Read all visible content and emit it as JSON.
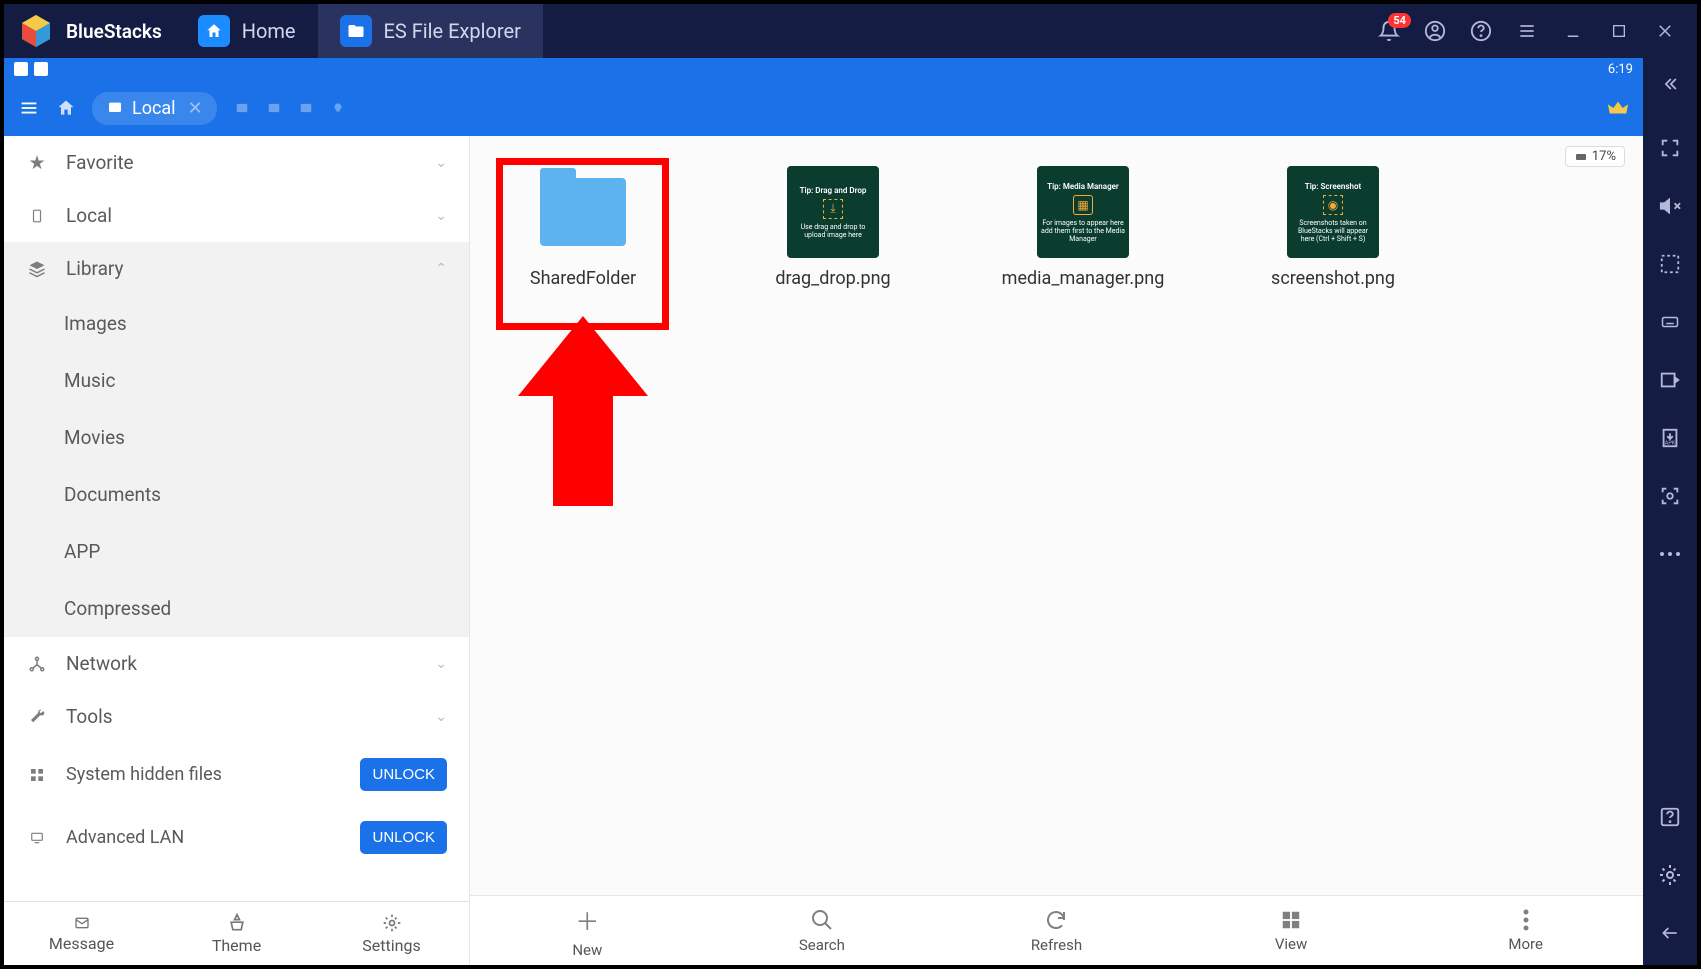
{
  "brand": "BlueStacks",
  "tabs": [
    {
      "label": "Home",
      "icon": "home-icon"
    },
    {
      "label": "ES File Explorer",
      "icon": "es-icon"
    }
  ],
  "notification_count": "54",
  "statusbar_time": "6:19",
  "breadcrumb_current": "Local",
  "analyze_badge": "17%",
  "sidebar": {
    "sections": [
      {
        "label": "Favorite",
        "icon": "star"
      },
      {
        "label": "Local",
        "icon": "phone"
      },
      {
        "label": "Library",
        "icon": "stack",
        "expanded": true
      },
      {
        "label": "Network",
        "icon": "network"
      },
      {
        "label": "Tools",
        "icon": "wrench"
      }
    ],
    "library_items": [
      "Images",
      "Music",
      "Movies",
      "Documents",
      "APP",
      "Compressed"
    ],
    "unlock_rows": [
      {
        "label": "System hidden files",
        "button": "UNLOCK"
      },
      {
        "label": "Advanced LAN",
        "button": "UNLOCK"
      }
    ],
    "bottom": [
      "Message",
      "Theme",
      "Settings"
    ]
  },
  "files": [
    {
      "name": "SharedFolder",
      "type": "folder"
    },
    {
      "name": "drag_drop.png",
      "type": "tip",
      "tip_title": "Tip: Drag and Drop",
      "tip_text": "Use drag and drop to upload image here"
    },
    {
      "name": "media_manager.png",
      "type": "tip",
      "tip_title": "Tip: Media Manager",
      "tip_text": "For images to appear here add them first to the Media Manager"
    },
    {
      "name": "screenshot.png",
      "type": "tip",
      "tip_title": "Tip: Screenshot",
      "tip_text": "Screenshots taken on BlueStacks will appear here (Ctrl + Shift + S)"
    }
  ],
  "bottom_actions": [
    "New",
    "Search",
    "Refresh",
    "View",
    "More"
  ]
}
